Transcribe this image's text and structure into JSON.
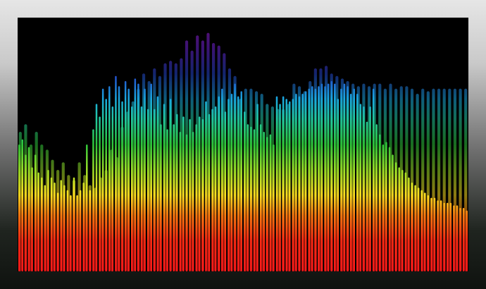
{
  "visualizer": {
    "bar_levels": [
      0.5,
      0.52,
      0.46,
      0.49,
      0.41,
      0.46,
      0.39,
      0.37,
      0.34,
      0.4,
      0.37,
      0.35,
      0.31,
      0.36,
      0.34,
      0.32,
      0.3,
      0.37,
      0.3,
      0.32,
      0.35,
      0.5,
      0.32,
      0.56,
      0.66,
      0.61,
      0.72,
      0.68,
      0.73,
      0.65,
      0.77,
      0.73,
      0.67,
      0.75,
      0.72,
      0.65,
      0.76,
      0.74,
      0.65,
      0.72,
      0.64,
      0.74,
      0.64,
      0.69,
      0.58,
      0.66,
      0.56,
      0.68,
      0.58,
      0.62,
      0.55,
      0.61,
      0.54,
      0.6,
      0.55,
      0.58,
      0.61,
      0.6,
      0.67,
      0.62,
      0.64,
      0.65,
      0.69,
      0.72,
      0.63,
      0.68,
      0.7,
      0.74,
      0.69,
      0.71,
      0.63,
      0.58,
      0.57,
      0.56,
      0.66,
      0.58,
      0.55,
      0.53,
      0.54,
      0.5,
      0.69,
      0.66,
      0.69,
      0.68,
      0.67,
      0.68,
      0.7,
      0.69,
      0.7,
      0.71,
      0.72,
      0.73,
      0.72,
      0.73,
      0.74,
      0.73,
      0.74,
      0.75,
      0.74,
      0.68,
      0.72,
      0.74,
      0.73,
      0.7,
      0.72,
      0.7,
      0.66,
      0.65,
      0.59,
      0.65,
      0.72,
      0.58,
      0.54,
      0.5,
      0.51,
      0.49,
      0.46,
      0.43,
      0.41,
      0.4,
      0.39,
      0.37,
      0.35,
      0.34,
      0.33,
      0.32,
      0.31,
      0.3,
      0.29,
      0.29,
      0.28,
      0.28,
      0.27,
      0.27,
      0.27,
      0.26,
      0.26,
      0.25,
      0.25,
      0.24
    ],
    "peak_levels": [
      0.55,
      0.58,
      0.5,
      0.55,
      0.5,
      0.48,
      0.44,
      0.4,
      0.43,
      0.38,
      0.36,
      0.43,
      0.38,
      0.34,
      0.33,
      0.37,
      0.4,
      0.48,
      0.45,
      0.57,
      0.63,
      0.67,
      0.72,
      0.78,
      0.75,
      0.8,
      0.77,
      0.82,
      0.83,
      0.82,
      0.84,
      0.91,
      0.87,
      0.93,
      0.91,
      0.94,
      0.9,
      0.89,
      0.86,
      0.8,
      0.77,
      0.68,
      0.72,
      0.72,
      0.71,
      0.7,
      0.66,
      0.65,
      0.64,
      0.64,
      0.66,
      0.74,
      0.73,
      0.71,
      0.75,
      0.8,
      0.8,
      0.81,
      0.78,
      0.77,
      0.76,
      0.75,
      0.74,
      0.73,
      0.74,
      0.73,
      0.74,
      0.74,
      0.72,
      0.74,
      0.72,
      0.73,
      0.73,
      0.72,
      0.7,
      0.72,
      0.71,
      0.72,
      0.72,
      0.72,
      0.72,
      0.72,
      0.72,
      0.72
    ],
    "peak_color": "#1e2a8a",
    "gradient_colors": [
      "#ff1a1a",
      "#ff7a10",
      "#ffe020",
      "#9be028",
      "#2ec63a",
      "#22c9a0",
      "#1aa8e0",
      "#2442c8",
      "#8a1ad0"
    ]
  }
}
